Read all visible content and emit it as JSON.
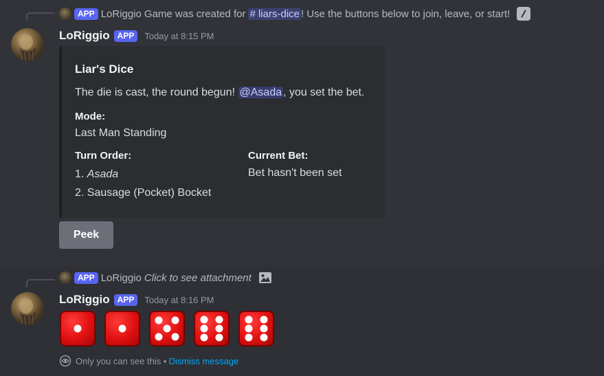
{
  "message1": {
    "reply": {
      "app_badge": "APP",
      "author": "LoRiggio",
      "text_before": "Game was created for",
      "channel": "# liars-dice",
      "text_after": "! Use the buttons below to join, leave, or start!",
      "icon": "slash-command-icon"
    },
    "author": "LoRiggio",
    "app_badge": "APP",
    "timestamp": "Today at 8:15 PM",
    "embed": {
      "title": "Liar's Dice",
      "desc_before": "The die is cast, the round begun!",
      "mention": "@Asada",
      "desc_after": ", you set the bet.",
      "mode_name": "Mode:",
      "mode_value": "Last Man Standing",
      "turn_order_name": "Turn Order:",
      "turn_order": [
        {
          "prefix": "1. ",
          "name": "Asada"
        },
        {
          "prefix": "",
          "name": "2. Sausage (Pocket) Bocket"
        }
      ],
      "current_bet_name": "Current Bet:",
      "current_bet_value": "Bet hasn't been set"
    },
    "button_label": "Peek"
  },
  "message2": {
    "reply": {
      "app_badge": "APP",
      "author": "LoRiggio",
      "text": "Click to see attachment",
      "icon": "image-icon"
    },
    "author": "LoRiggio",
    "app_badge": "APP",
    "timestamp": "Today at 8:16 PM",
    "dice": [
      1,
      1,
      5,
      6,
      6
    ],
    "ephemeral_text": "Only you can see this •",
    "dismiss_label": "Dismiss message"
  },
  "colors": {
    "background": "#313338",
    "accent": "#5865f2",
    "link": "#00a8fc",
    "dice": "#e01010"
  }
}
